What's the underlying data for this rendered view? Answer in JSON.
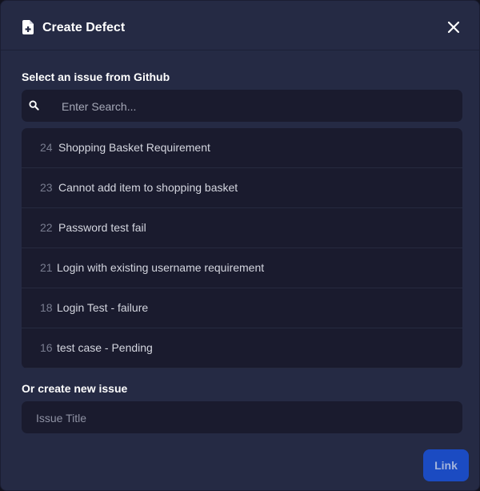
{
  "dialog": {
    "title": "Create Defect",
    "title_icon": "document-plus-icon",
    "close_icon": "close-icon"
  },
  "select_section": {
    "label": "Select an issue from Github",
    "search_placeholder": "Enter Search...",
    "search_icon": "search-icon"
  },
  "issues": [
    {
      "number": "24",
      "title": "Shopping Basket Requirement"
    },
    {
      "number": "23",
      "title": "Cannot add item to shopping basket"
    },
    {
      "number": "22",
      "title": "Password test fail"
    },
    {
      "number": "21",
      "title": "Login with existing username requirement"
    },
    {
      "number": "18",
      "title": "Login Test - failure"
    },
    {
      "number": "16",
      "title": "test case - Pending"
    }
  ],
  "create_section": {
    "label": "Or create new issue",
    "title_placeholder": "Issue Title"
  },
  "footer": {
    "link_label": "Link"
  },
  "colors": {
    "modal_bg": "#252a44",
    "field_bg": "#1a1b2e",
    "primary_button": "#1b4bc2"
  }
}
